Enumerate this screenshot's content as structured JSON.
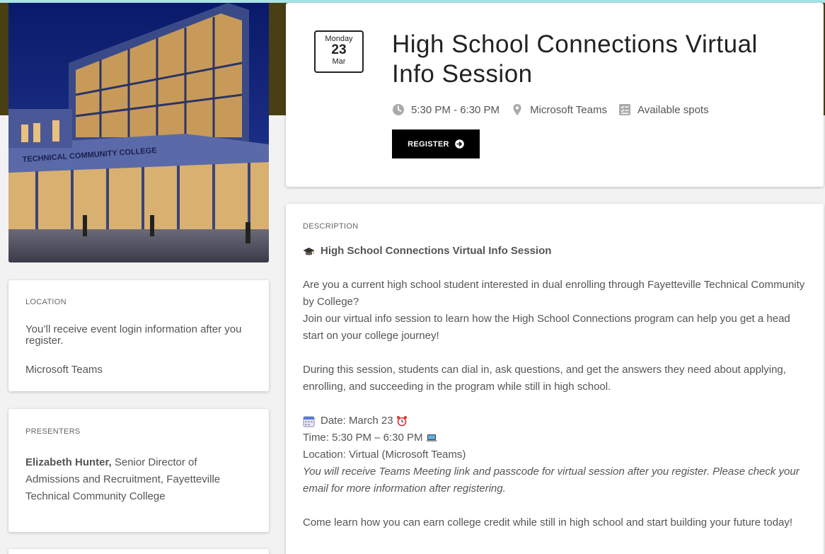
{
  "event": {
    "date": {
      "weekday": "Monday",
      "day": "23",
      "month": "Mar"
    },
    "title": "High School Connections Virtual Info Session",
    "time": "5:30 PM - 6:30 PM",
    "venue": "Microsoft Teams",
    "spots": "Available spots",
    "register_label": "REGISTER"
  },
  "location": {
    "label": "LOCATION",
    "info": "You’ll receive event login information after you register.",
    "place": "Microsoft Teams"
  },
  "presenters": {
    "label": "PRESENTERS",
    "name": "Elizabeth Hunter,",
    "role": " Senior Director of Admissions and Recruitment, Fayetteville Technical Community College"
  },
  "description": {
    "label": "DESCRIPTION",
    "heading": "High School Connections Virtual Info Session",
    "p1_line1": "Are you a current high school student interested in dual enrolling through Fayetteville Technical Community by College?",
    "p1_line2": "Join our virtual info session to learn how the High School Connections program can help you get a head start on your college journey!",
    "p2": "During this session, students can dial in, ask questions, and get the answers they need about applying, enrolling, and succeeding in the program while still in high school.",
    "date_line": "Date: March 23",
    "time_line": "Time: 5:30 PM – 6:30 PM",
    "location_line": "Location: Virtual (Microsoft Teams)",
    "note": "You will receive Teams Meeting link and passcode for virtual session after you register. Please check your email for more information after registering.",
    "closing": "Come learn how you can earn college credit while still in high school and start building your future today!"
  },
  "icons": {
    "clock": "clock-icon",
    "map_pin": "map-pin-icon",
    "spots": "checklist-icon",
    "arrow": "arrow-circle-right-icon",
    "grad_cap": "graduation-cap-emoji",
    "calendar": "calendar-emoji",
    "alarm": "alarm-clock-emoji",
    "laptop": "laptop-emoji"
  },
  "colors": {
    "banner": "#4a3f14",
    "accent_strip": "#a9e3e6",
    "button": "#000000",
    "background": "#f2f2f2"
  }
}
